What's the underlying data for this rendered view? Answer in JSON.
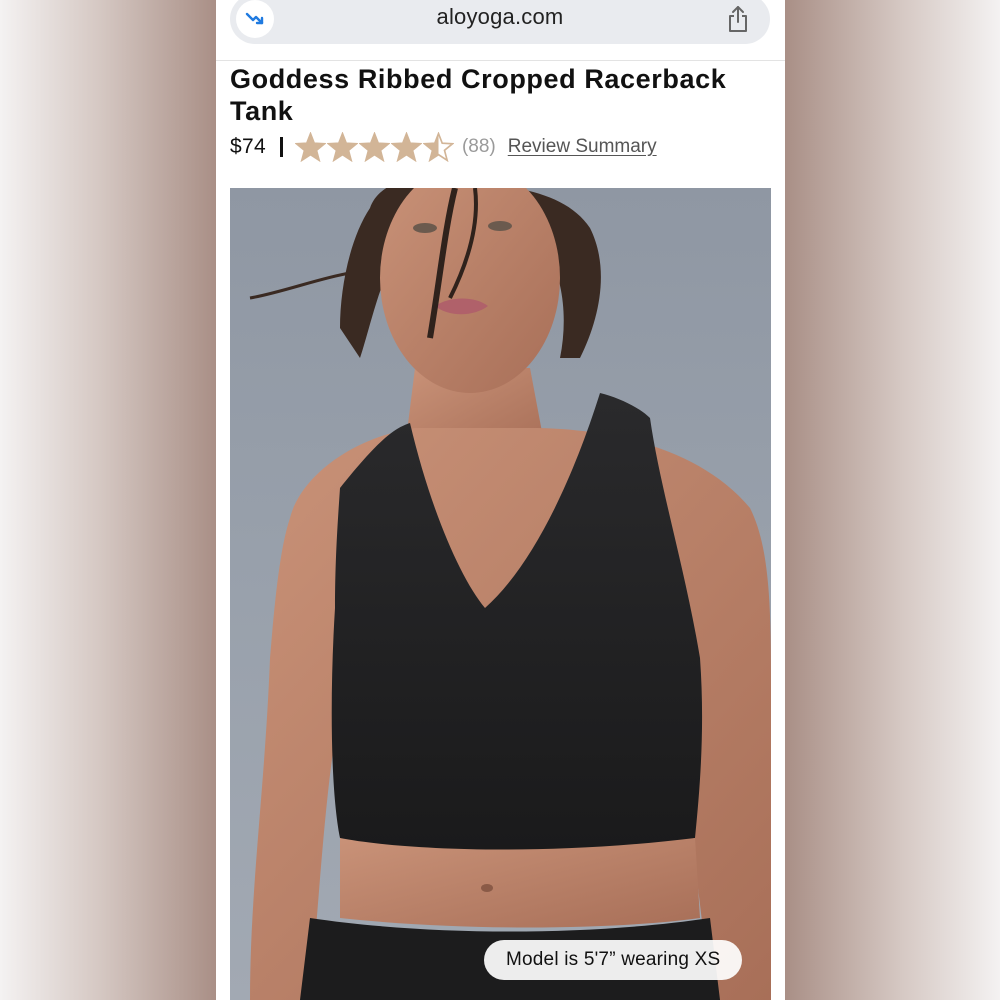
{
  "browser": {
    "url": "aloyoga.com",
    "left_icon": "trend-arrow-icon",
    "share_icon": "share-icon"
  },
  "product": {
    "title": "Goddess Ribbed Cropped Racerback Tank",
    "price": "$74",
    "rating": 4.5,
    "rating_max": 5,
    "review_count": "(88)",
    "review_link": "Review Summary",
    "star_color": "#d2b597"
  },
  "image": {
    "caption": "Model is 5'7” wearing XS",
    "background_color": "#98a0ab"
  }
}
